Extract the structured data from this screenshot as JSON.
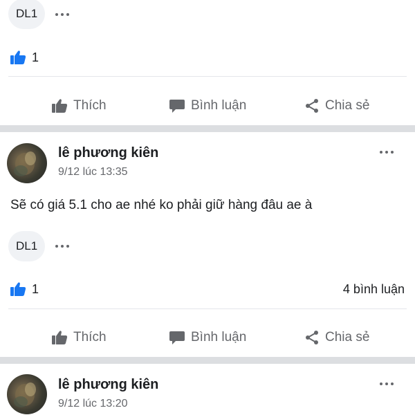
{
  "colors": {
    "like_blue": "#1877f2",
    "muted": "#65676b",
    "chip_bg": "#f0f2f5"
  },
  "top_post": {
    "tag_chip": "DL1",
    "like_count": "1",
    "actions": {
      "like": "Thích",
      "comment": "Bình luận",
      "share": "Chia sẻ"
    }
  },
  "post_1": {
    "author": "lê phương kiên",
    "time": "9/12 lúc 13:35",
    "text": "Sẽ có giá 5.1 cho ae nhé ko phải giữ hàng đâu ae à",
    "tag_chip": "DL1",
    "like_count": "1",
    "comment_count": "4 bình luận",
    "actions": {
      "like": "Thích",
      "comment": "Bình luận",
      "share": "Chia sẻ"
    }
  },
  "post_2": {
    "author": "lê phương kiên",
    "time": "9/12 lúc 13:20"
  },
  "icons": [
    "more-dots-icon",
    "thumbs-up-filled-icon",
    "thumbs-up-outline-icon",
    "comment-bubble-icon",
    "share-icon"
  ]
}
